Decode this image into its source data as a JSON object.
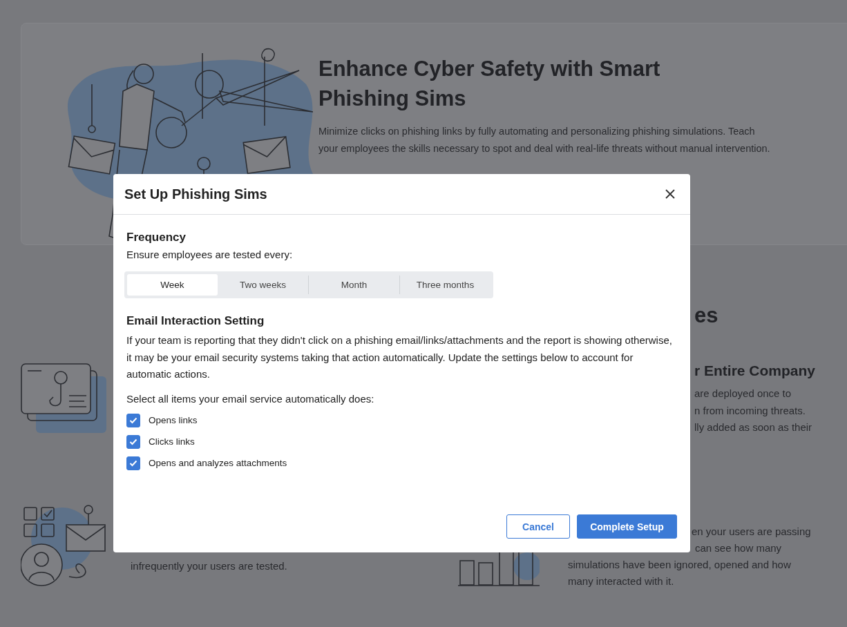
{
  "hero": {
    "title": "Enhance Cyber Safety with Smart Phishing Sims",
    "description": "Minimize clicks on phishing links by fully automating and personalizing phishing  simulations. Teach your employees the skills necessary to spot and deal with real-life threats without manual intervention."
  },
  "section": {
    "heading_fragment": "es"
  },
  "features": [
    {
      "title": "r Entire Company",
      "lines": [
        "are deployed once to",
        "n from incoming threats.",
        "lly added as soon as their"
      ]
    },
    {
      "lines": [
        "infrequently your users are tested."
      ]
    },
    {
      "lines": [
        "en your users are passing",
        "can see how many",
        "simulations have been ignored, opened and how",
        "many interacted with it."
      ]
    }
  ],
  "dialog": {
    "title": "Set Up Phishing Sims",
    "frequency": {
      "heading": "Frequency",
      "prompt": "Ensure employees are tested every:",
      "options": [
        {
          "label": "Week",
          "selected": true
        },
        {
          "label": "Two weeks",
          "selected": false
        },
        {
          "label": "Month",
          "selected": false
        },
        {
          "label": "Three months",
          "selected": false
        }
      ]
    },
    "email": {
      "heading": "Email Interaction Setting",
      "description": "If your team is reporting that they didn't click on a phishing email/links/attachments and the report is showing otherwise, it may be your email security systems taking that action automatically. Update the settings below to account for automatic actions.",
      "prompt": "Select all items your email service automatically does:",
      "items": [
        {
          "label": "Opens links",
          "checked": true
        },
        {
          "label": "Clicks links",
          "checked": true
        },
        {
          "label": "Opens and analyzes attachments",
          "checked": true
        }
      ]
    },
    "buttons": [
      {
        "label": "Cancel",
        "kind": "secondary"
      },
      {
        "label": "Complete Setup",
        "kind": "primary"
      }
    ]
  }
}
